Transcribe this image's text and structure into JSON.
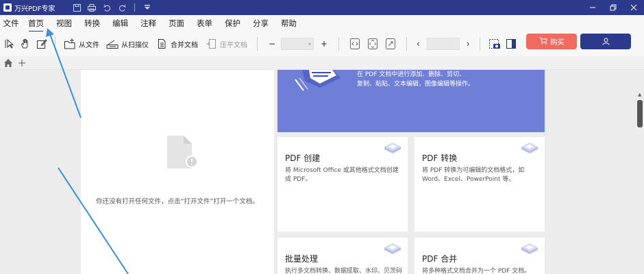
{
  "app": {
    "title": "万兴PDF专家"
  },
  "menu": {
    "items": [
      "文件",
      "首页",
      "视图",
      "转换",
      "编辑",
      "注释",
      "页面",
      "表单",
      "保护",
      "分享",
      "帮助"
    ],
    "active": "首页"
  },
  "toolbar": {
    "from_file": "从文件",
    "from_scanner": "从扫描仪",
    "merge_docs": "合并文档",
    "flatten": "压平文档",
    "zoom_minus": "−",
    "zoom_plus": "+",
    "page_prev": "‹",
    "page_next": "›",
    "buy": "购买"
  },
  "empty_state": {
    "message": "你还没有打开任何文件，点击“打开文件”打开一个文档。"
  },
  "banner": {
    "line1": "在 PDF 文档中进行添加、删除、剪切、",
    "line2": "复制、粘贴、文本编辑，图像编辑等操作。"
  },
  "cards": [
    {
      "title": "PDF 创建",
      "desc": "将 Microsoft Office 或其他格式文档创建成 PDF。"
    },
    {
      "title": "PDF 转换",
      "desc": "将 PDF 转换为可编辑的文档格式，如 Word、Excel、PowerPoint 等。"
    },
    {
      "title": "批量处理",
      "desc": "执行多文档转换、数据提取、水印、贝茨码"
    },
    {
      "title": "PDF 合并",
      "desc": "将多种格式文档合并为一个 PDF 文档。"
    }
  ],
  "colors": {
    "titlebar": "#2c3a8c",
    "accent": "#2c3a8c",
    "buy": "#f06a60",
    "banner": "#6f7ed6",
    "annotation": "#3a8fd8"
  }
}
